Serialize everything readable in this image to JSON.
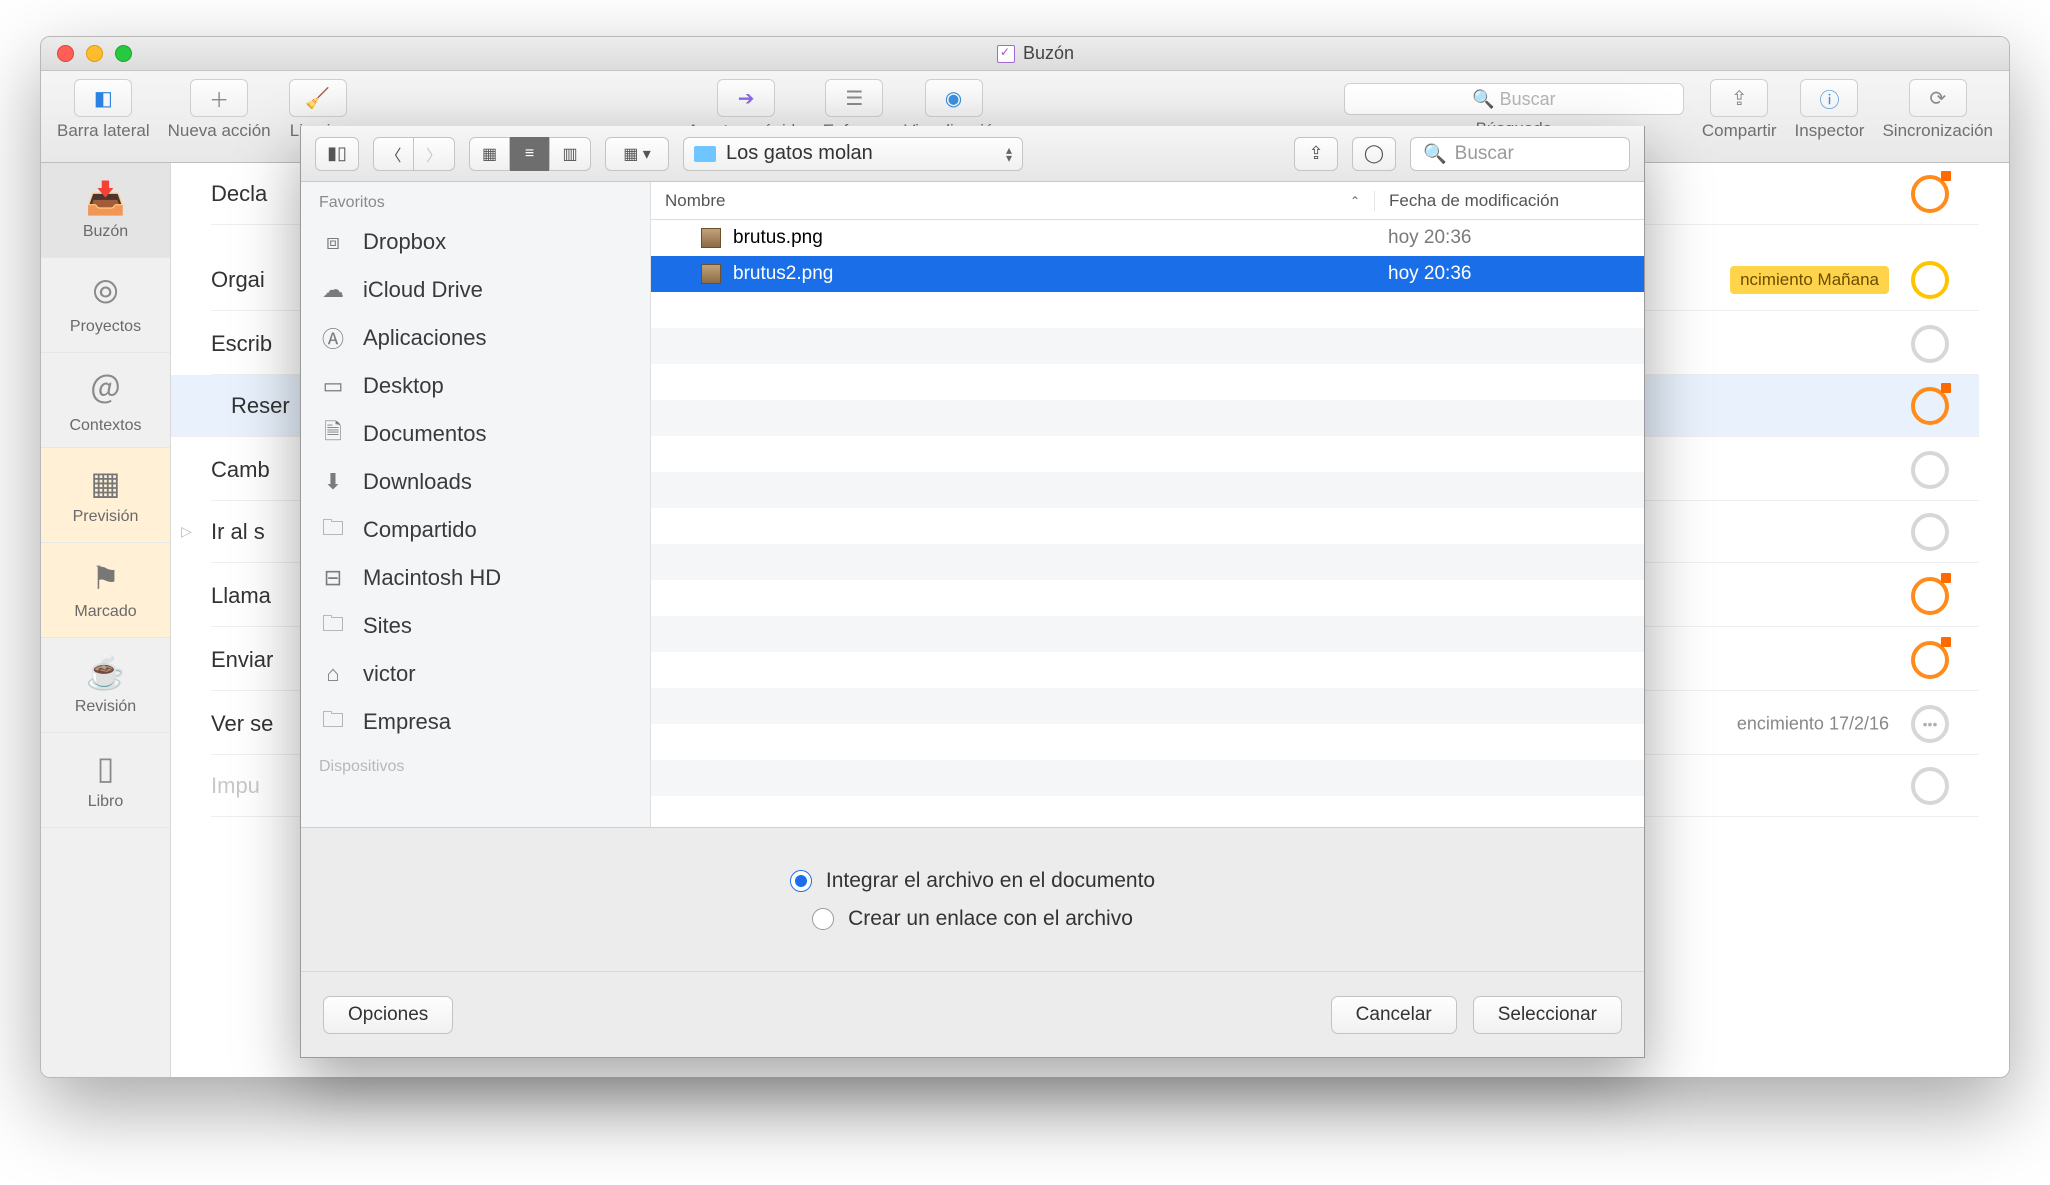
{
  "window": {
    "title": "Buzón"
  },
  "toolbar": {
    "sidebar": "Barra lateral",
    "new_action": "Nueva acción",
    "clean": "Limpiar",
    "quick_open": "Apertura rápida",
    "focus": "Enfoque",
    "view": "Visualización",
    "search_placeholder": "Buscar",
    "search_label": "Búsqueda",
    "share": "Compartir",
    "inspector": "Inspector",
    "sync": "Sincronización"
  },
  "nav": {
    "inbox": "Buzón",
    "projects": "Proyectos",
    "contexts": "Contextos",
    "forecast": "Previsión",
    "flagged": "Marcado",
    "review": "Revisión",
    "book": "Libro"
  },
  "tasks": {
    "t0": "Decla",
    "t1": "Orgai",
    "t2": "Escrib",
    "t3": "Reser",
    "t4": "Camb",
    "t5": "Ir al s",
    "t6": "Llama",
    "t7": "Enviar",
    "t8": "Ver se",
    "t9": "Impu",
    "tag_tomorrow": "ncimiento Mañana",
    "due_date": "encimiento 17/2/16"
  },
  "sheet": {
    "path": "Los gatos molan",
    "search_placeholder": "Buscar",
    "sidebar_header": "Favoritos",
    "sidebar_header2": "Dispositivos",
    "favorites": {
      "dropbox": "Dropbox",
      "icloud": "iCloud Drive",
      "apps": "Aplicaciones",
      "desktop": "Desktop",
      "documents": "Documentos",
      "downloads": "Downloads",
      "shared": "Compartido",
      "hd": "Macintosh HD",
      "sites": "Sites",
      "home": "victor",
      "empresa": "Empresa"
    },
    "columns": {
      "name": "Nombre",
      "modified": "Fecha de modificación"
    },
    "rows": [
      {
        "name": "brutus.png",
        "date": "hoy 20:36",
        "selected": false
      },
      {
        "name": "brutus2.png",
        "date": "hoy 20:36",
        "selected": true
      }
    ],
    "opt_embed": "Integrar el archivo en el documento",
    "opt_link": "Crear un enlace con el archivo",
    "options_btn": "Opciones",
    "cancel_btn": "Cancelar",
    "select_btn": "Seleccionar"
  }
}
